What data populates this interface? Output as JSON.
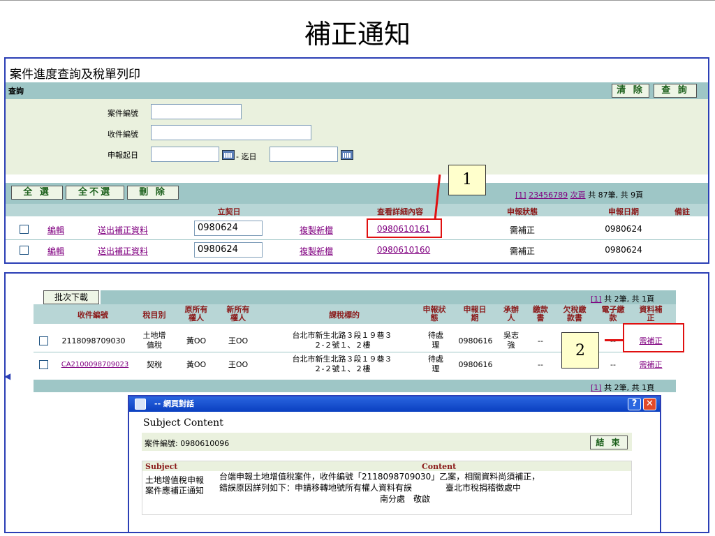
{
  "slide_title": "補正通知",
  "panel1": {
    "title": "案件進度查詢及稅單列印",
    "query_label": "查詢",
    "clear_button": "清 除",
    "search_button": "查 詢",
    "case_no_label": "案件編號",
    "receipt_no_label": "收件編號",
    "date_from_label": "申報起日",
    "date_to_label": "- 迄日",
    "select_all": "全 選",
    "select_none": "全不選",
    "delete": "刪 除",
    "pager": {
      "current": "[1]",
      "pages": [
        "2",
        "3",
        "4",
        "5",
        "6",
        "7",
        "8",
        "9"
      ],
      "next": "次頁",
      "summary": "共 87筆, 共 9頁"
    },
    "headers": {
      "contract_date": "立契日",
      "detail": "查看詳細內容",
      "status": "申報狀態",
      "report_date": "申報日期",
      "remark": "備註"
    },
    "rows": [
      {
        "edit": "編輯",
        "send": "送出補正資料",
        "contract_date": "0980624",
        "copy": "複製新檔",
        "detail": "0980610161",
        "status": "需補正",
        "report_date": "0980624"
      },
      {
        "edit": "編輯",
        "send": "送出補正資料",
        "contract_date": "0980624",
        "copy": "複製新檔",
        "detail": "0980610160",
        "status": "需補正",
        "report_date": "0980624"
      }
    ]
  },
  "callouts": {
    "first": "1",
    "second": "2"
  },
  "panel2": {
    "batch_download": "批次下載",
    "pager_top": "共 2筆, 共 1頁",
    "pager_page": "[1]",
    "pager_bottom": "共 2筆, 共 1頁",
    "headers": {
      "receipt_no": "收件編號",
      "tax_type": "稅目別",
      "orig_owner": "原所有\n權人",
      "new_owner": "新所有\n權人",
      "tax_object": "課稅標的",
      "report_status": "申報狀\n態",
      "report_date": "申報日\n期",
      "handler": "承辦\n人",
      "payment": "繳款\n書",
      "arrears": "欠稅繳\n款書",
      "e_payment": "電子繳\n款",
      "supplement": "資料補\n正"
    },
    "rows": [
      {
        "receipt_no": "2118098709030",
        "tax_type": "土地增\n值稅",
        "orig_owner": "黃OO",
        "new_owner": "王OO",
        "tax_object": "台北市新生北路３段１９巷３\n２-２號１、２樓",
        "report_status": "待處\n理",
        "report_date": "0980616",
        "handler": "吳志\n強",
        "payment": "--",
        "arrears": "",
        "e_payment": "--",
        "supplement": "需補正"
      },
      {
        "receipt_no": "CA2100098709023",
        "tax_type": "契稅",
        "orig_owner": "黃OO",
        "new_owner": "王OO",
        "tax_object": "台北市新生北路３段１９巷３\n２-２號１、２樓",
        "report_status": "待處\n理",
        "report_date": "0980616",
        "handler": "",
        "payment": "--",
        "arrears": "",
        "e_payment": "--",
        "supplement": "需補正"
      }
    ]
  },
  "dialog": {
    "title": "-- 網頁對話",
    "help_btn": "?",
    "close_btn": "✕",
    "heading": "Subject Content",
    "case_no": "案件編號: 0980610096",
    "end_button": "結 束",
    "subject_header": "Subject",
    "content_header": "Content",
    "subject": "土地增值稅申報\n案件應補正通知",
    "content_line1": "台端申報土地增值稅案件，收件編號「2118098709030」乙案，相關資料尚須補正，",
    "content_line2": "錯誤原因詳列如下：申請移轉地號所有權人資料有誤　　　　臺北市稅捐稽徵處中",
    "content_line3": "南分處　敬啟"
  },
  "colors": {
    "panel_border": "#2b3fb5",
    "bar": "#9ec6c6",
    "form_bg": "#eaf1de",
    "highlight": "#e01010",
    "callout_bg": "#ffffcc",
    "link": "#800080"
  }
}
